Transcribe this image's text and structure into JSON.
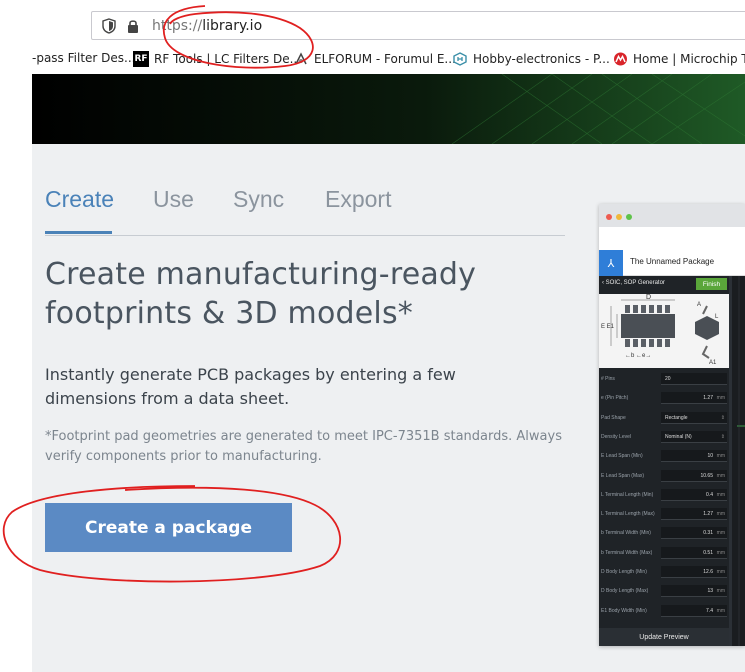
{
  "browser": {
    "url_protocol": "https://",
    "url_host": "library.io",
    "bookmarks": [
      {
        "label": "-pass Filter Des...",
        "icon": "none"
      },
      {
        "label": "RF Tools | LC Filters De...",
        "icon": "rf-logo-icon"
      },
      {
        "label": "ELFORUM - Forumul E...",
        "icon": "elforum-icon"
      },
      {
        "label": "Hobby-electronics - P...",
        "icon": "hobby-electronics-icon"
      },
      {
        "label": "Home | Microchip Te",
        "icon": "microchip-icon"
      }
    ]
  },
  "tabs": [
    {
      "label": "Create",
      "active": true
    },
    {
      "label": "Use",
      "active": false
    },
    {
      "label": "Sync",
      "active": false
    },
    {
      "label": "Export",
      "active": false
    }
  ],
  "headline": "Create manufacturing-ready footprints & 3D models*",
  "lead": "Instantly generate PCB packages by entering a few dimensions from a data sheet.",
  "footnote": "*Footprint pad geometries are generated to meet IPC-7351B standards. Always verify components prior to manufacturing.",
  "cta_label": "Create a package",
  "colors": {
    "accent": "#4a82b8",
    "button": "#5b8ac4",
    "page_bg": "#eef0f2",
    "annotation": "#e02020",
    "finish_green": "#5aa63a"
  },
  "preview": {
    "logo_glyph": "⅄",
    "package_name": "The Unnamed Package",
    "generator": "‹  SOIC, SOP Generator",
    "finish_label": "Finish",
    "diagram_labels": {
      "d": "D",
      "e_e1": "E  E1",
      "b_e": "←b    ←e→",
      "a": "A",
      "l": "L",
      "a1": "A1"
    },
    "fields": [
      {
        "label": "# Pins",
        "value": "20",
        "unit": "",
        "kind": "text"
      },
      {
        "label": "e (Pin Pitch)",
        "value": "1.27",
        "unit": "mm",
        "kind": "num"
      },
      {
        "label": "Pad Shape",
        "value": "Rectangle",
        "unit": "⇕",
        "kind": "select"
      },
      {
        "label": "Density Level",
        "value": "Nominal (N)",
        "unit": "⇕",
        "kind": "select"
      },
      {
        "label": "E Lead Span (Min)",
        "value": "10",
        "unit": "mm",
        "kind": "num"
      },
      {
        "label": "E Lead Span (Max)",
        "value": "10.65",
        "unit": "mm",
        "kind": "num"
      },
      {
        "label": "L Terminal Length (Min)",
        "value": "0.4",
        "unit": "mm",
        "kind": "num"
      },
      {
        "label": "L Terminal Length (Max)",
        "value": "1.27",
        "unit": "mm",
        "kind": "num"
      },
      {
        "label": "b Terminal Width (Min)",
        "value": "0.31",
        "unit": "mm",
        "kind": "num"
      },
      {
        "label": "b Terminal Width (Max)",
        "value": "0.51",
        "unit": "mm",
        "kind": "num"
      },
      {
        "label": "D Body Length (Min)",
        "value": "12.6",
        "unit": "mm",
        "kind": "num"
      },
      {
        "label": "D Body Length (Max)",
        "value": "13",
        "unit": "mm",
        "kind": "num"
      },
      {
        "label": "E1 Body Width (Min)",
        "value": "7.4",
        "unit": "mm",
        "kind": "num"
      }
    ],
    "update_label": "Update Preview"
  }
}
